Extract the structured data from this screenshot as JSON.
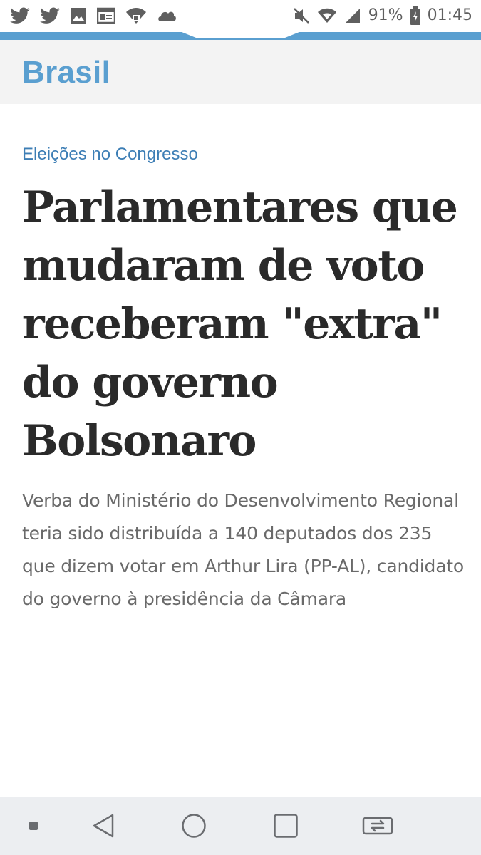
{
  "status_bar": {
    "icons_left": [
      "twitter-icon",
      "twitter-icon",
      "gallery-icon",
      "news-icon",
      "wifi-lock-icon",
      "cloud-icon"
    ],
    "icons_right": [
      "mute-icon",
      "wifi-icon",
      "signal-icon",
      "battery-icon"
    ],
    "battery_percent": "91%",
    "time": "01:45"
  },
  "colors": {
    "accent": "#5a9fd0",
    "kicker": "#3d7eb5",
    "headline": "#2a2a2a",
    "subtitle": "#6a6a6a"
  },
  "section": {
    "title": "Brasil"
  },
  "article": {
    "kicker": "Eleições no Congresso",
    "headline": "Parlamentares que mudaram de voto receberam \"extra\" do governo Bolsonaro",
    "subtitle": "Verba do Ministério do Desenvolvimento Regional teria sido distribuída a 140 deputados dos 235 que dizem votar em Arthur Lira (PP-AL), candidato do governo à presidência da Câmara"
  },
  "nav_bar": {
    "buttons": [
      "dot-icon",
      "back-icon",
      "home-icon",
      "recents-icon",
      "rotate-screen-icon"
    ]
  }
}
